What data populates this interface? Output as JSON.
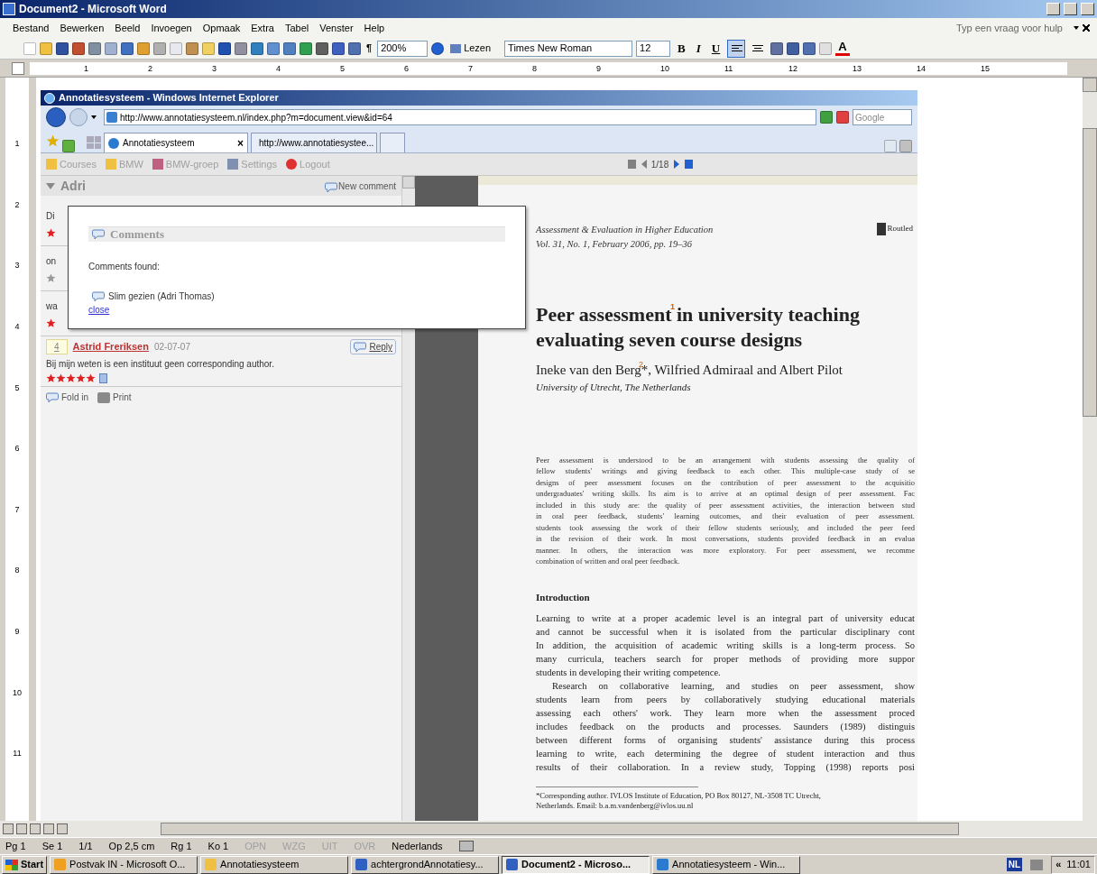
{
  "word": {
    "title": "Document2 - Microsoft Word",
    "menu": [
      "Bestand",
      "Bewerken",
      "Beeld",
      "Invoegen",
      "Opmaak",
      "Extra",
      "Tabel",
      "Venster",
      "Help"
    ],
    "help_search": {
      "placeholder": "Typ een vraag voor hulp"
    },
    "toolbar": {
      "paragraph_mark": "¶",
      "zoom": "200%",
      "read_button": "Lezen",
      "font": "Times New Roman",
      "size": "12",
      "bold": "B",
      "italic": "I",
      "underline": "U",
      "font_color": "A",
      "align": [
        {
          "selected": true
        },
        {
          "selected": false
        }
      ]
    },
    "ruler": [
      "1",
      "2",
      "3",
      "4",
      "5",
      "6",
      "7",
      "8",
      "9",
      "10",
      "11",
      "12",
      "13",
      "14",
      "15"
    ],
    "vertical_ruler": [
      "1",
      "2",
      "3",
      "4",
      "5",
      "6",
      "7",
      "8",
      "9",
      "10",
      "11"
    ]
  },
  "browser": {
    "title": "Annotatiesysteem - Windows Internet Explorer",
    "address": "http://www.annotatiesysteem.nl/index.php?m=document.view&id=64",
    "search": {
      "placeholder": "Google"
    },
    "tabs": [
      {
        "label": "Annotatiesysteem",
        "selected": true,
        "close": "×"
      },
      {
        "label": "http://www.annotatiesystee...",
        "selected": false
      }
    ],
    "app_menu": [
      {
        "label": "Courses"
      },
      {
        "label": "BMW"
      },
      {
        "label": "BMW-groep"
      },
      {
        "label": "Settings"
      },
      {
        "label": "Logout"
      }
    ],
    "pager": "1/18",
    "panel": {
      "user": "Adri",
      "new_comment": "New comment",
      "hidden_rows": [
        {
          "fragment": "Di",
          "color": "#e02020"
        },
        {
          "fragment": "on",
          "color": "#999999"
        },
        {
          "fragment": "wa",
          "color": "#e02020"
        }
      ],
      "comment": {
        "number": "4",
        "author": "Astrid Freriksen",
        "date": "02-07-07",
        "reply": "Reply",
        "text": "Bij mijn weten is een instituut geen corresponding author.",
        "stars": 5
      },
      "footer": [
        "Fold in",
        "Print"
      ]
    },
    "popup": {
      "title": "Comments",
      "found": "Comments found:",
      "items": [
        "Slim gezien (Adri Thomas)"
      ],
      "close": "close"
    },
    "document": {
      "journal": "Assessment & Evaluation in Higher Education",
      "volume": "Vol. 31, No. 1, February 2006, pp. 19–36",
      "logo": "Routled",
      "title_lines": [
        "Peer assessment in university teaching",
        "evaluating seven course designs"
      ],
      "title_marker": "1",
      "authors": "Ineke van den Berg*, Wilfried Admiraal and Albert Pilot",
      "author_marker": "2",
      "affiliation": "University of Utrecht, The Netherlands",
      "abstract": [
        "Peer assessment is understood to be an arrangement with students assessing the quality of",
        "fellow students' writings and giving feedback to each other. This multiple-case study of se",
        "designs of peer assessment focuses on the contribution of peer assessment to the acquisitio",
        "undergraduates' writing skills. Its aim is to arrive at an optimal design of peer assessment. Fac",
        "included in this study are: the quality of peer assessment activities, the interaction between stud",
        "in oral peer feedback, students' learning outcomes, and their evaluation of peer assessment.",
        "students took assessing the work of their fellow students seriously, and included the peer feed",
        "in the revision of their work. In most conversations, students provided feedback in an evalua",
        "manner. In others, the interaction was more exploratory. For peer assessment, we recomme",
        "combination of written and oral peer feedback."
      ],
      "heading": "Introduction",
      "paragraphs": [
        [
          "Learning to write at a proper academic level is an integral part of university educat",
          "and cannot be successful when it is isolated from the particular disciplinary cont",
          "In addition, the acquisition of academic writing skills is a long-term process. So",
          "many curricula, teachers search for proper methods of providing more suppor",
          "students in developing their writing competence."
        ],
        [
          "Research on collaborative learning, and studies on peer assessment, show",
          "students learn from peers by collaboratively studying educational materials",
          "assessing each others' work. They learn more when the assessment proced",
          "includes feedback on the products and processes. Saunders (1989) distinguis",
          "between different forms of organising students' assistance during this process",
          "learning to write, each determining the degree of student interaction and thus",
          "results of their collaboration. In a review study, Topping (1998) reports posi"
        ]
      ],
      "footnote": [
        "*Corresponding author. IVLOS Institute of Education, PO Box 80127, NL-3508 TC Utrecht,",
        "Netherlands. Email: b.a.m.vandenberg@ivlos.uu.nl"
      ]
    }
  },
  "status_bar": [
    {
      "label": "Pg 1",
      "disabled": false
    },
    {
      "label": "Se 1",
      "disabled": false
    },
    {
      "label": "1/1",
      "disabled": false
    },
    {
      "label": "Op 2,5 cm",
      "disabled": false
    },
    {
      "label": "Rg 1",
      "disabled": false
    },
    {
      "label": "Ko 1",
      "disabled": false
    },
    {
      "label": "OPN",
      "disabled": true
    },
    {
      "label": "WZG",
      "disabled": true
    },
    {
      "label": "UIT",
      "disabled": true
    },
    {
      "label": "OVR",
      "disabled": true
    },
    {
      "label": "Nederlands",
      "disabled": false
    }
  ],
  "taskbar": {
    "start": "Start",
    "buttons": [
      {
        "label": "Postvak IN - Microsoft O...",
        "selected": false
      },
      {
        "label": "Annotatiesysteem",
        "selected": false
      },
      {
        "label": "achtergrondAnnotatiesy...",
        "selected": false
      },
      {
        "label": "Document2 - Microso...",
        "selected": true
      },
      {
        "label": "Annotatiesysteem - Win...",
        "selected": false
      }
    ],
    "language": "NL",
    "expand": "«",
    "clock": "11:01"
  }
}
